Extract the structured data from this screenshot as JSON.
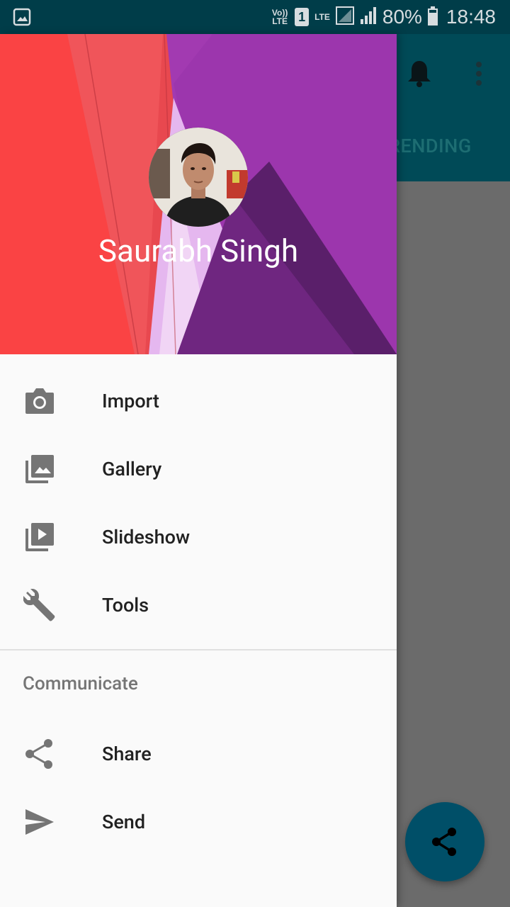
{
  "status_bar": {
    "volte": "Vo)) LTE",
    "sim": "1",
    "lte": "LTE",
    "battery": "80%",
    "time": "18:48"
  },
  "app": {
    "tab_label": "RENDING"
  },
  "drawer": {
    "user_name": "Saurabh Singh",
    "items": [
      {
        "label": "Import",
        "icon": "camera-icon"
      },
      {
        "label": "Gallery",
        "icon": "gallery-icon"
      },
      {
        "label": "Slideshow",
        "icon": "slideshow-icon"
      },
      {
        "label": "Tools",
        "icon": "wrench-icon"
      }
    ],
    "section_title": "Communicate",
    "communicate_items": [
      {
        "label": "Share",
        "icon": "share-icon"
      },
      {
        "label": "Send",
        "icon": "send-icon"
      }
    ]
  },
  "colors": {
    "status_bar": "#003d49",
    "toolbar": "#004a57",
    "fab": "#004f68",
    "drawer_bg": "#fafafa"
  }
}
